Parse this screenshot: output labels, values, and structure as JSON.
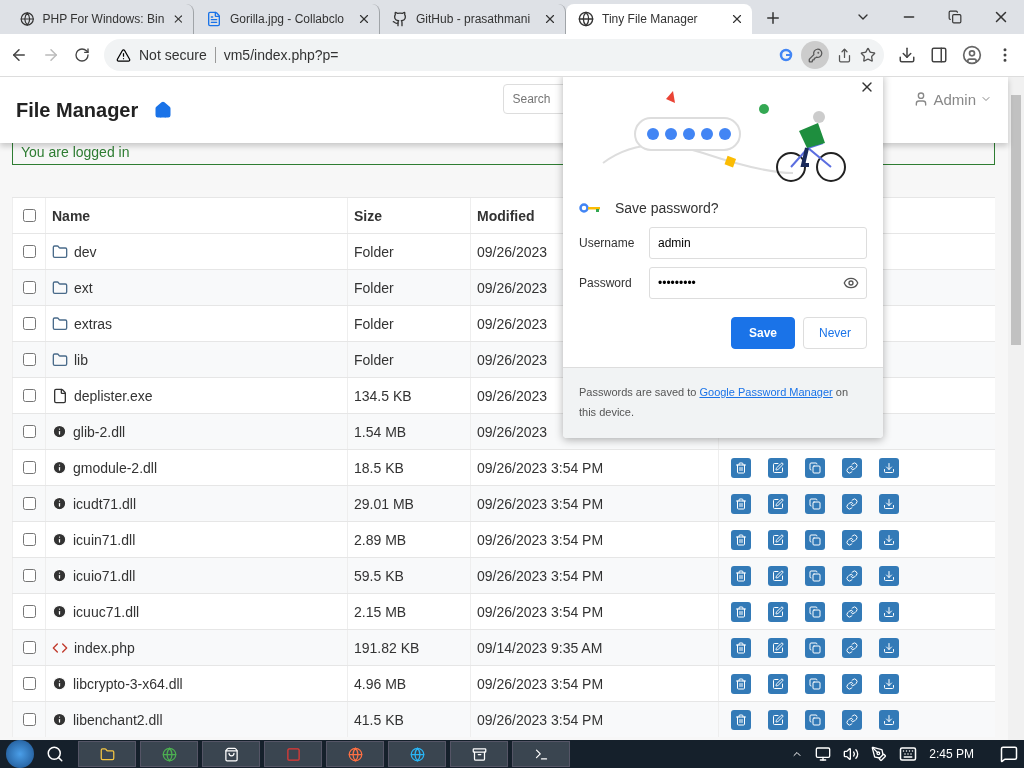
{
  "browser": {
    "tabs": [
      {
        "title": "PHP For Windows: Bin",
        "selected": false,
        "kind": "globe"
      },
      {
        "title": "Gorilla.jpg - Collabclo",
        "selected": false,
        "kind": "document"
      },
      {
        "title": "GitHub - prasathmani",
        "selected": false,
        "kind": "octocat"
      },
      {
        "title": "Tiny File Manager",
        "selected": true,
        "kind": "globe"
      }
    ],
    "security": "Not secure",
    "url": "vm5/index.php?p="
  },
  "page": {
    "brand": "File Manager",
    "search": {
      "placeholder": "Search"
    },
    "user": "Admin",
    "alert": "You are logged in",
    "select_all_checked": false,
    "columns": [
      "Name",
      "Size",
      "Modified"
    ],
    "rows": [
      {
        "name": "dev",
        "kind": "folder",
        "size": "Folder",
        "modified": "09/26/2023",
        "actions": false,
        "checked": false
      },
      {
        "name": "ext",
        "kind": "folder",
        "size": "Folder",
        "modified": "09/26/2023",
        "actions": false,
        "checked": false
      },
      {
        "name": "extras",
        "kind": "folder",
        "size": "Folder",
        "modified": "09/26/2023",
        "actions": false,
        "checked": false
      },
      {
        "name": "lib",
        "kind": "folder",
        "size": "Folder",
        "modified": "09/26/2023",
        "actions": false,
        "checked": false
      },
      {
        "name": "deplister.exe",
        "kind": "file",
        "size": "134.5 KB",
        "modified": "09/26/2023",
        "actions": false,
        "checked": false
      },
      {
        "name": "glib-2.dll",
        "kind": "info",
        "size": "1.54 MB",
        "modified": "09/26/2023",
        "actions": false,
        "checked": false
      },
      {
        "name": "gmodule-2.dll",
        "kind": "info",
        "size": "18.5 KB",
        "modified": "09/26/2023 3:54 PM",
        "actions": true,
        "checked": false
      },
      {
        "name": "icudt71.dll",
        "kind": "info",
        "size": "29.01 MB",
        "modified": "09/26/2023 3:54 PM",
        "actions": true,
        "checked": false
      },
      {
        "name": "icuin71.dll",
        "kind": "info",
        "size": "2.89 MB",
        "modified": "09/26/2023 3:54 PM",
        "actions": true,
        "checked": false
      },
      {
        "name": "icuio71.dll",
        "kind": "info",
        "size": "59.5 KB",
        "modified": "09/26/2023 3:54 PM",
        "actions": true,
        "checked": false
      },
      {
        "name": "icuuc71.dll",
        "kind": "info",
        "size": "2.15 MB",
        "modified": "09/26/2023 3:54 PM",
        "actions": true,
        "checked": false
      },
      {
        "name": "index.php",
        "kind": "code",
        "size": "191.82 KB",
        "modified": "09/14/2023 9:35 AM",
        "actions": true,
        "checked": false
      },
      {
        "name": "libcrypto-3-x64.dll",
        "kind": "info",
        "size": "4.96 MB",
        "modified": "09/26/2023 3:54 PM",
        "actions": true,
        "checked": false
      },
      {
        "name": "libenchant2.dll",
        "kind": "info",
        "size": "41.5 KB",
        "modified": "09/26/2023 3:54 PM",
        "actions": true,
        "checked": false
      }
    ]
  },
  "popup": {
    "title": "Save password?",
    "username_label": "Username",
    "username": "admin",
    "password_label": "Password",
    "password": "•••••••••",
    "save": "Save",
    "never": "Never",
    "footer_before": "Passwords are saved to",
    "footer_link": "Google Password Manager",
    "footer_after": "on this device."
  },
  "taskbar": {
    "time": "2:45 PM"
  }
}
